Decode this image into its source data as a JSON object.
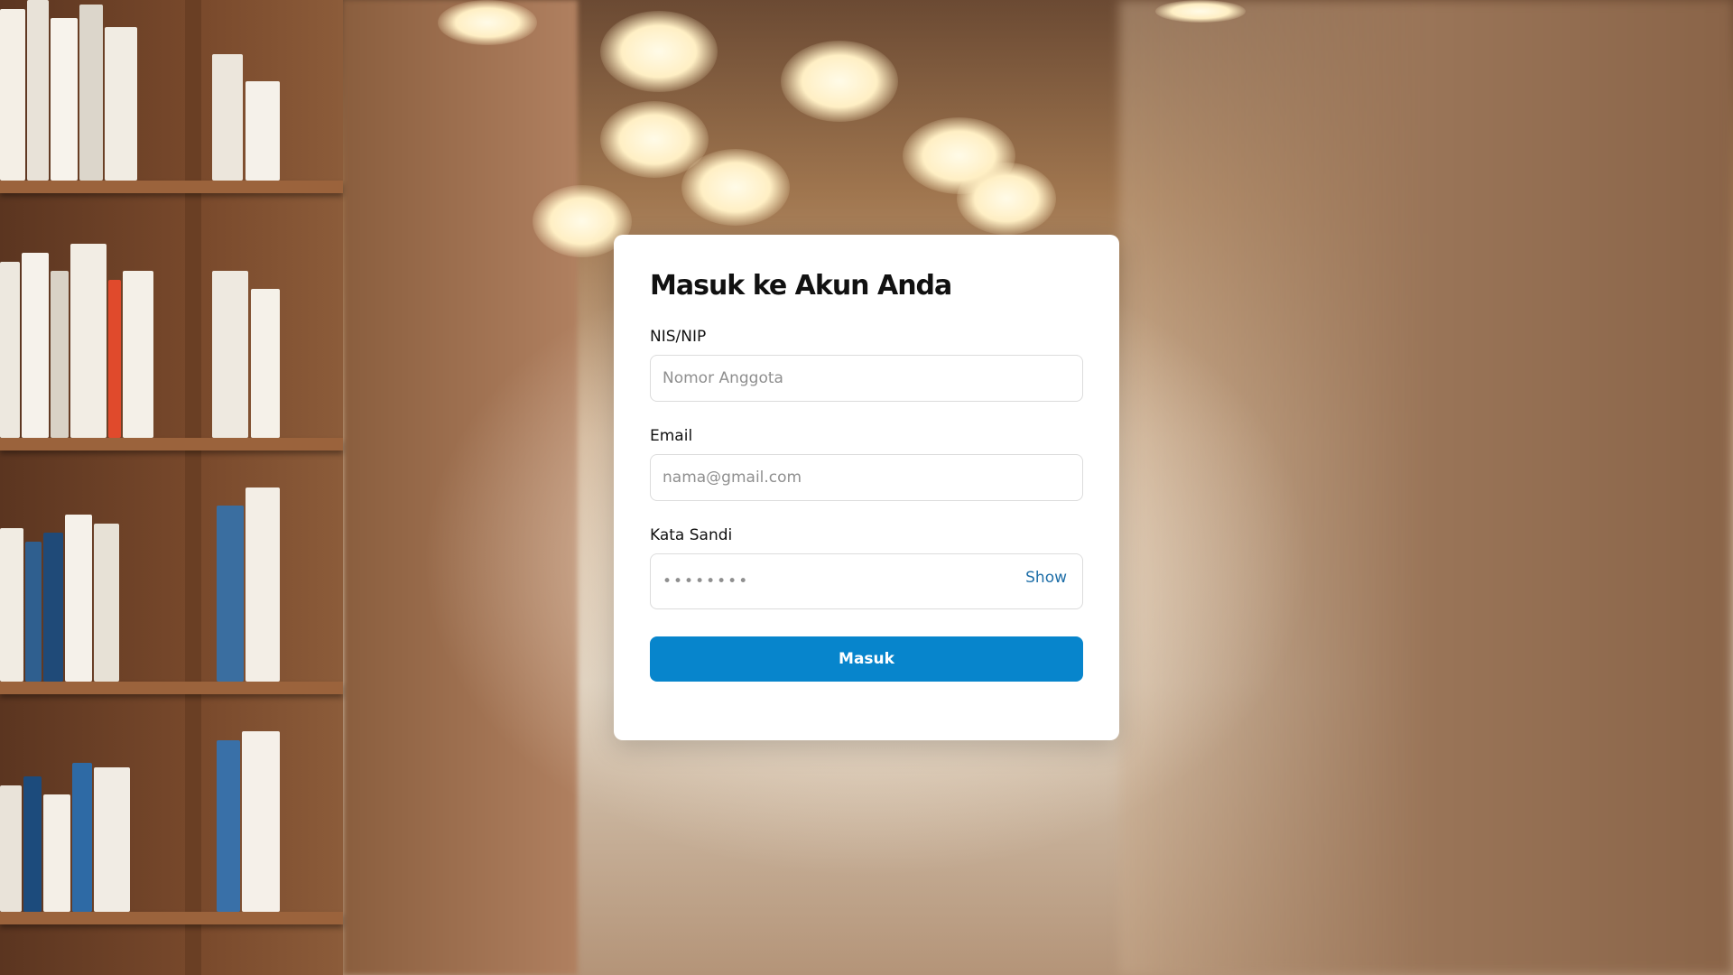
{
  "login": {
    "title": "Masuk ke Akun Anda",
    "member_id": {
      "label": "NIS/NIP",
      "placeholder": "Nomor Anggota",
      "value": ""
    },
    "email": {
      "label": "Email",
      "placeholder": "nama@gmail.com",
      "value": ""
    },
    "password": {
      "label": "Kata Sandi",
      "placeholder": "••••••••",
      "value": "",
      "toggle_label": "Show"
    },
    "submit_label": "Masuk"
  },
  "colors": {
    "accent": "#0785cc",
    "link": "#1f6fa8",
    "card_background": "#ffffff",
    "title_text": "#111111",
    "input_border": "#dcdcdc",
    "placeholder_text": "#8f8f8f"
  }
}
